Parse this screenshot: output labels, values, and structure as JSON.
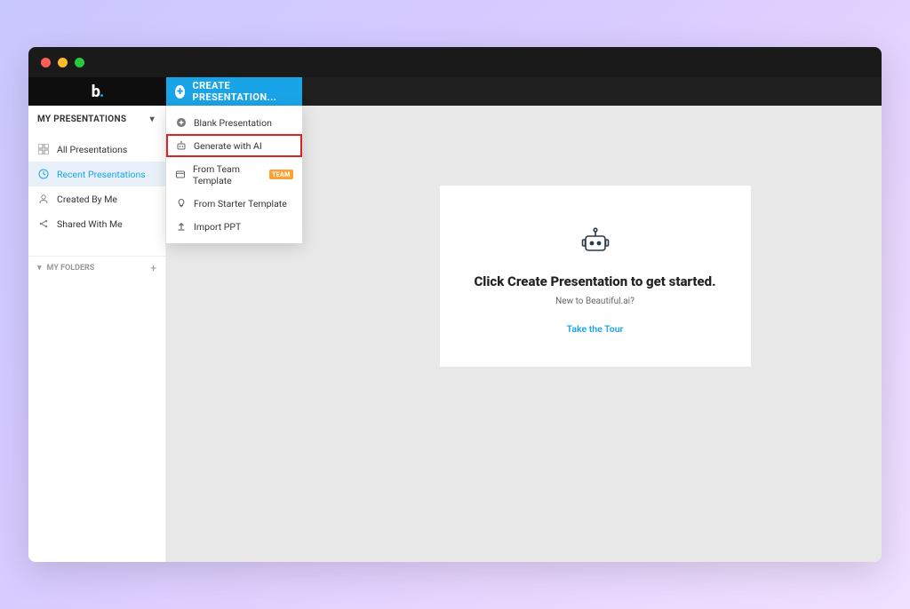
{
  "topbar": {
    "create_label": "CREATE PRESENTATION..."
  },
  "sidebar": {
    "header": "MY PRESENTATIONS",
    "items": [
      {
        "label": "All Presentations"
      },
      {
        "label": "Recent Presentations"
      },
      {
        "label": "Created By Me"
      },
      {
        "label": "Shared With Me"
      }
    ],
    "folders_label": "MY FOLDERS"
  },
  "dropdown": {
    "items": [
      {
        "label": "Blank Presentation"
      },
      {
        "label": "Generate with AI"
      },
      {
        "label": "From Team Template",
        "badge": "TEAM"
      },
      {
        "label": "From Starter Template"
      },
      {
        "label": "Import PPT"
      }
    ]
  },
  "card": {
    "title": "Click Create Presentation to get started.",
    "subtitle": "New to Beautiful.ai?",
    "link": "Take the Tour"
  }
}
